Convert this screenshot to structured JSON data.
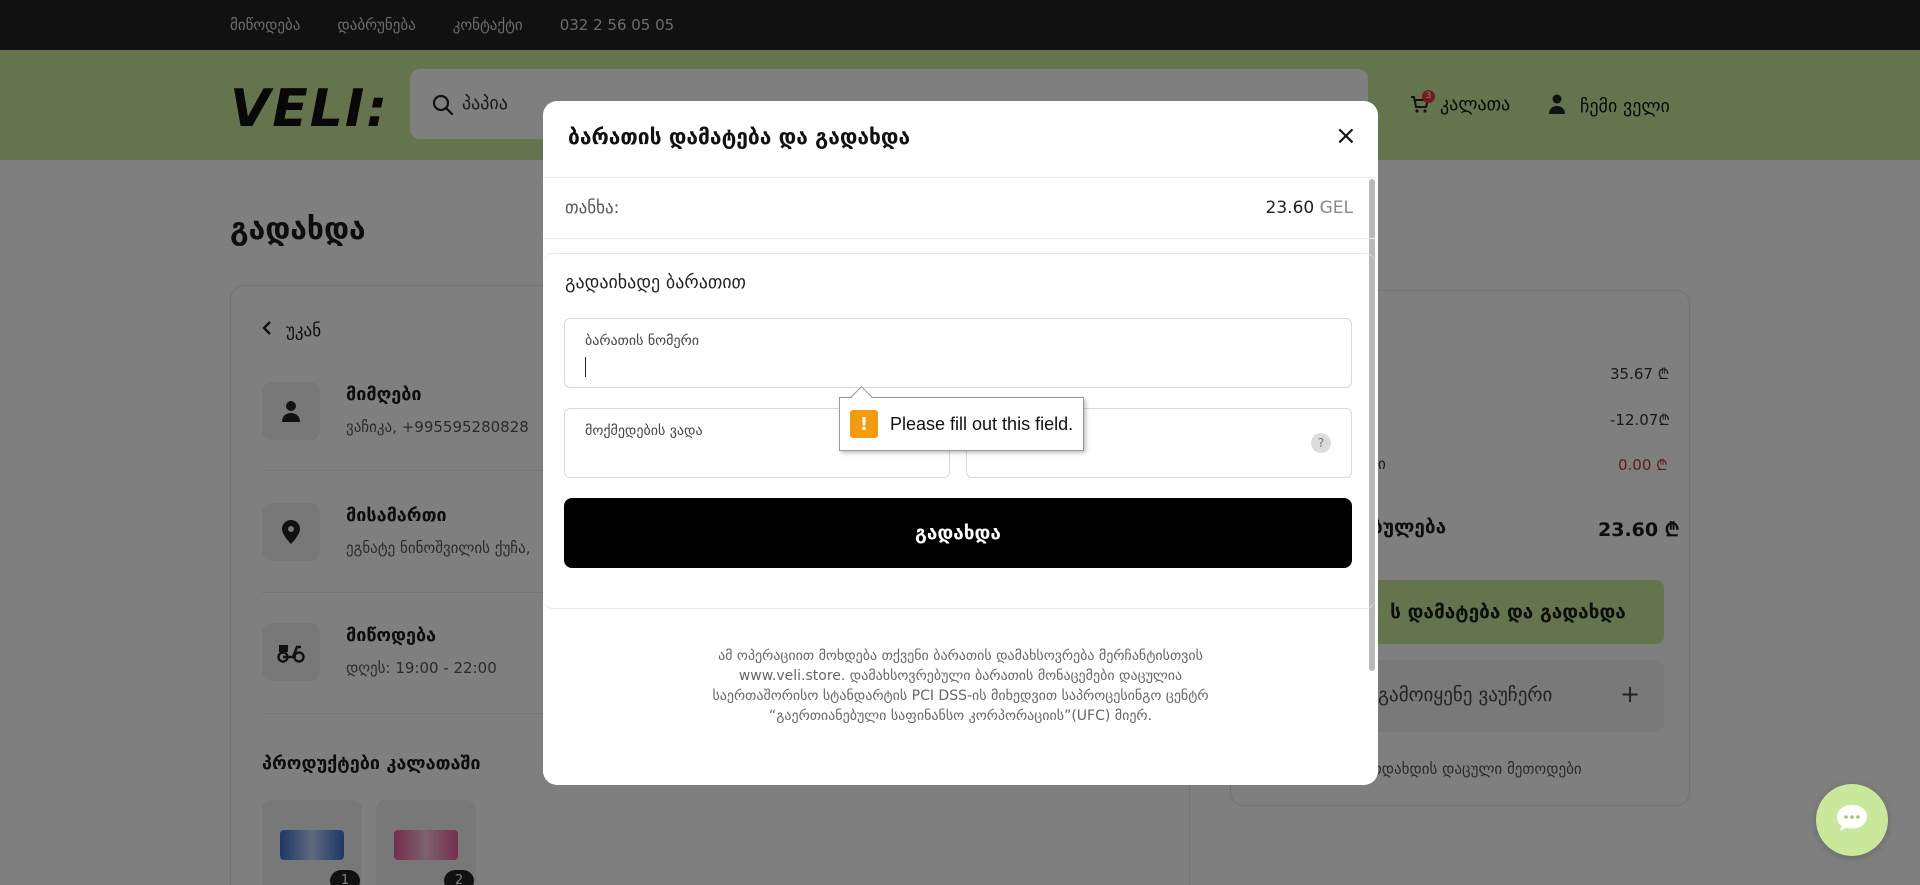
{
  "topbar": {
    "links": [
      "მიწოდება",
      "დაბრუნება",
      "კონტაქტი",
      "032 2 56 05 05"
    ]
  },
  "header": {
    "logo": "VELI:",
    "search_value": "პაპია",
    "cart_label": "კალათა",
    "cart_count": "3",
    "account_label": "ჩემი ველი",
    "brand_color": "#c9e89b"
  },
  "page": {
    "title": "გადახდა",
    "back_label": "უკან",
    "recipient_title": "მიმღები",
    "recipient_value": "ვაჩიკა, +995595280828",
    "address_title": "მისამართი",
    "address_value": "ეგნატე ნინოშვილის ქუჩა,",
    "delivery_title": "მიწოდება",
    "delivery_value": "დღეს: 19:00 - 22:00",
    "products_title": "პროდუქტები კალათაში",
    "products": [
      {
        "qty": "1"
      },
      {
        "qty": "2"
      }
    ]
  },
  "summary": {
    "row1_value": "35.67 ₾",
    "row2_value": "-12.07₾",
    "row3_label_partial": "რი",
    "row3_value": "0.00 ₾",
    "total_label_partial": "ბულება",
    "total_value": "23.60 ₾",
    "pay_button_partial": "ს დამატება და გადახდა",
    "voucher_label_partial": "გამოიყენე ვაუჩერი",
    "voucher_plus": "+",
    "secure_partial": "ოდახდის დაცული მეთოდები"
  },
  "modal": {
    "title": "ბარათის დამატება და გადახდა",
    "close": "×",
    "amount_label": "თანხა:",
    "amount_value": "23.60",
    "amount_currency": "GEL",
    "section_title": "გადაიხადე ბარათით",
    "card_number_label": "ბარათის ნომერი",
    "expiry_label": "მოქმედების ვადა",
    "cvv_help": "?",
    "submit_label": "გადახდა",
    "disclaimer": "ამ ოპერაციით მოხდება თქვენი ბარათის დამახსოვრება მერჩანტისთვის www.veli.store. დამახსოვრებული ბარათის მონაცემები დაცულია საერთაშორისო სტანდარტის PCI DSS-ის მიხედვით საპროცესინგო ცენტრ “გაერთიანებული საფინანსო კორპორაციის”(UFC) მიერ."
  },
  "validation": {
    "icon": "!",
    "message": "Please fill out this field."
  }
}
